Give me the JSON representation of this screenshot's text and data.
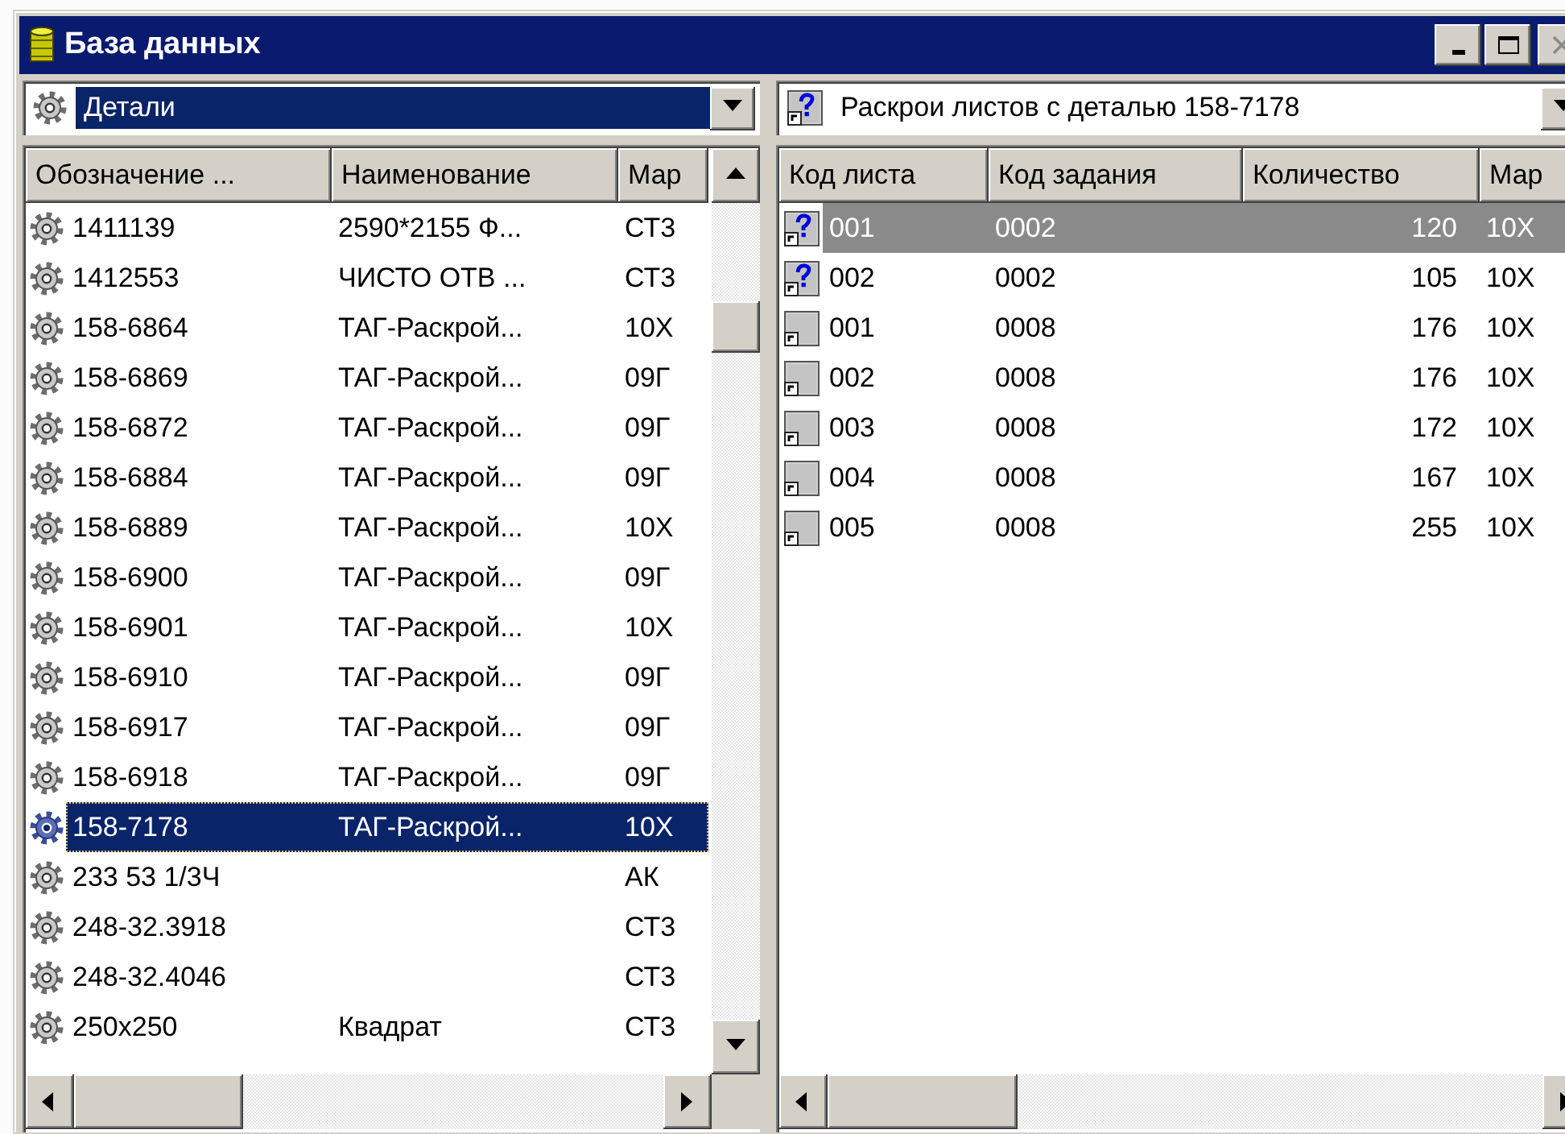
{
  "window": {
    "title": "База данных"
  },
  "left_panel": {
    "combo": {
      "value": "Детали"
    },
    "columns": [
      "Обозначение ...",
      "Наименование",
      "Мар"
    ],
    "rows": [
      {
        "cells": [
          "1411139",
          "2590*2155 Ф...",
          "СТ3"
        ],
        "selected": false
      },
      {
        "cells": [
          "1412553",
          "ЧИСТО ОТВ ...",
          "СТ3"
        ],
        "selected": false
      },
      {
        "cells": [
          "158-6864",
          "ТАГ-Раскрой...",
          "10Х"
        ],
        "selected": false
      },
      {
        "cells": [
          "158-6869",
          "ТАГ-Раскрой...",
          "09Г"
        ],
        "selected": false
      },
      {
        "cells": [
          "158-6872",
          "ТАГ-Раскрой...",
          "09Г"
        ],
        "selected": false
      },
      {
        "cells": [
          "158-6884",
          "ТАГ-Раскрой...",
          "09Г"
        ],
        "selected": false
      },
      {
        "cells": [
          "158-6889",
          "ТАГ-Раскрой...",
          "10Х"
        ],
        "selected": false
      },
      {
        "cells": [
          "158-6900",
          "ТАГ-Раскрой...",
          "09Г"
        ],
        "selected": false
      },
      {
        "cells": [
          "158-6901",
          "ТАГ-Раскрой...",
          "10Х"
        ],
        "selected": false
      },
      {
        "cells": [
          "158-6910",
          "ТАГ-Раскрой...",
          "09Г"
        ],
        "selected": false
      },
      {
        "cells": [
          "158-6917",
          "ТАГ-Раскрой...",
          "09Г"
        ],
        "selected": false
      },
      {
        "cells": [
          "158-6918",
          "ТАГ-Раскрой...",
          "09Г"
        ],
        "selected": false
      },
      {
        "cells": [
          "158-7178",
          "ТАГ-Раскрой...",
          "10Х"
        ],
        "selected": true
      },
      {
        "cells": [
          "233 53 1/3Ч",
          "",
          "АК"
        ],
        "selected": false
      },
      {
        "cells": [
          "248-32.3918",
          "",
          "СТ3"
        ],
        "selected": false
      },
      {
        "cells": [
          "248-32.4046",
          "",
          "СТ3"
        ],
        "selected": false
      },
      {
        "cells": [
          "250x250",
          "Квадрат",
          "СТ3"
        ],
        "selected": false
      }
    ]
  },
  "right_panel": {
    "combo": {
      "value": "Раскрои листов с деталью 158-7178"
    },
    "columns": [
      "Код листа",
      "Код задания",
      "Количество",
      "Мар"
    ],
    "rows": [
      {
        "kind": "query",
        "cells": [
          "001",
          "0002",
          "120",
          "10Х"
        ],
        "selected": true
      },
      {
        "kind": "query",
        "cells": [
          "002",
          "0002",
          "105",
          "10Х"
        ],
        "selected": false
      },
      {
        "kind": "sheet",
        "cells": [
          "001",
          "0008",
          "176",
          "10Х"
        ],
        "selected": false
      },
      {
        "kind": "sheet",
        "cells": [
          "002",
          "0008",
          "176",
          "10Х"
        ],
        "selected": false
      },
      {
        "kind": "sheet",
        "cells": [
          "003",
          "0008",
          "172",
          "10Х"
        ],
        "selected": false
      },
      {
        "kind": "sheet",
        "cells": [
          "004",
          "0008",
          "167",
          "10Х"
        ],
        "selected": false
      },
      {
        "kind": "sheet",
        "cells": [
          "005",
          "0008",
          "255",
          "10Х"
        ],
        "selected": false
      }
    ]
  }
}
